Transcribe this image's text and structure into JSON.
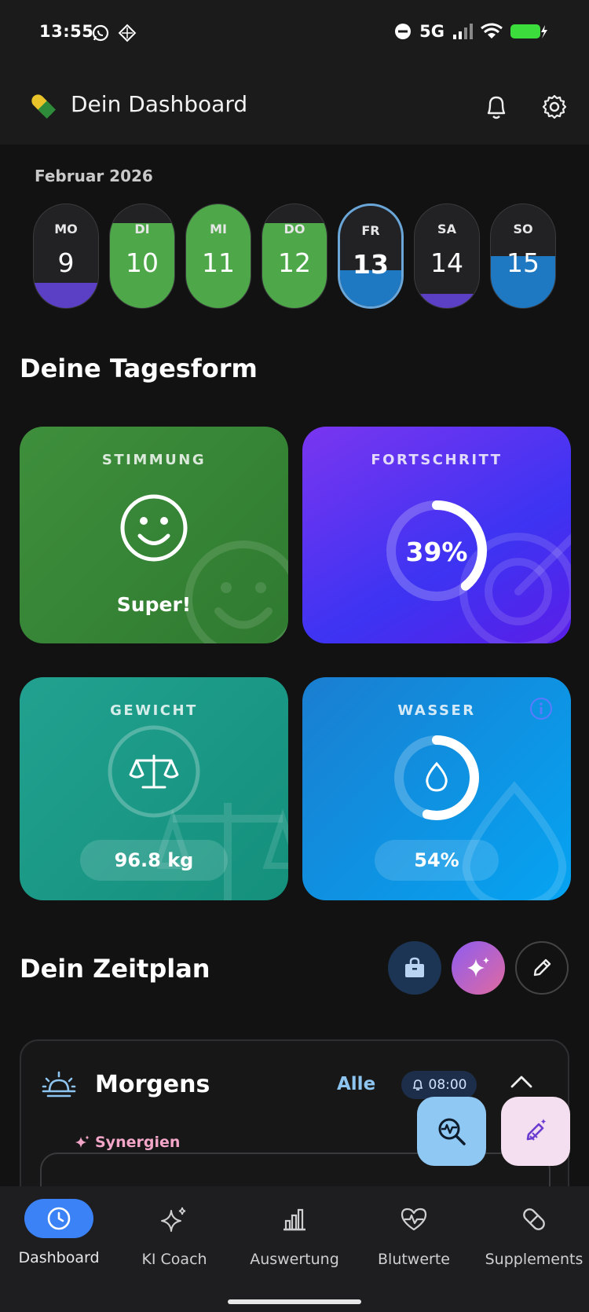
{
  "status": {
    "time": "13:55",
    "network": "5G"
  },
  "header": {
    "title": "Dein Dashboard"
  },
  "calendar": {
    "month": "Februar 2026",
    "days": [
      {
        "name": "MO",
        "num": "9",
        "fill": 0.24,
        "fill_color": "#5b3fc4",
        "active": false
      },
      {
        "name": "DI",
        "num": "10",
        "fill": 0.82,
        "fill_color": "#4ea84a",
        "active": false
      },
      {
        "name": "MI",
        "num": "11",
        "fill": 1.0,
        "fill_color": "#4ea84a",
        "active": false
      },
      {
        "name": "DO",
        "num": "12",
        "fill": 0.82,
        "fill_color": "#4ea84a",
        "active": false
      },
      {
        "name": "FR",
        "num": "13",
        "fill": 0.36,
        "fill_color": "#1f78c2",
        "active": true
      },
      {
        "name": "SA",
        "num": "14",
        "fill": 0.14,
        "fill_color": "#5b3fc4",
        "active": false
      },
      {
        "name": "SO",
        "num": "15",
        "fill": 0.5,
        "fill_color": "#1f78c2",
        "active": false
      }
    ]
  },
  "tagesform": {
    "title": "Deine Tagesform",
    "mood": {
      "label": "STIMMUNG",
      "value": "Super!"
    },
    "progress": {
      "label": "FORTSCHRITT",
      "value": "39%",
      "fraction": 0.39
    },
    "weight": {
      "label": "GEWICHT",
      "value": "96.8 kg"
    },
    "water": {
      "label": "WASSER",
      "value": "54%",
      "fraction": 0.54
    }
  },
  "zeitplan": {
    "title": "Dein Zeitplan",
    "section": "Morgens",
    "filter": "Alle",
    "time": "08:00",
    "synergy_label": "Synergien"
  },
  "nav": {
    "items": [
      {
        "label": "Dashboard"
      },
      {
        "label": "KI Coach"
      },
      {
        "label": "Auswertung"
      },
      {
        "label": "Blutwerte"
      },
      {
        "label": "Supplements"
      }
    ]
  },
  "colors": {
    "mood_card": "#3a8a3a",
    "progress_card": "#5a2ae8",
    "weight_card": "#1e9c88",
    "water_card": "#0f8fe0",
    "nav_active": "#3b82f6"
  }
}
